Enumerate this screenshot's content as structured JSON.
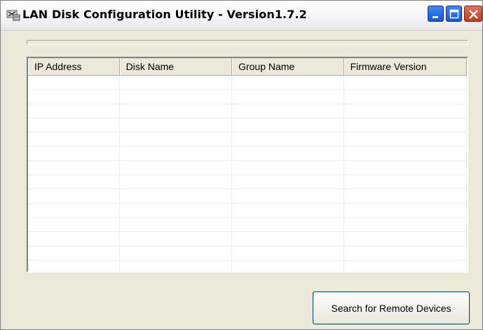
{
  "window": {
    "title": "LAN Disk Configuration Utility - Version1.7.2",
    "icon": "network-disk-icon"
  },
  "titlebar_buttons": [
    {
      "name": "minimize",
      "icon": "minimize-icon"
    },
    {
      "name": "maximize",
      "icon": "maximize-icon"
    },
    {
      "name": "close",
      "icon": "close-icon"
    }
  ],
  "progress": {
    "fraction": 0.0
  },
  "table": {
    "columns": [
      "IP Address",
      "Disk Name",
      "Group Name",
      "Firmware Version"
    ],
    "rows": []
  },
  "buttons": {
    "search_label": "Search for Remote Devices"
  },
  "colors": {
    "close_button": "#c23b1d",
    "window_button": "#1a56d8",
    "face": "#ece9d8"
  }
}
